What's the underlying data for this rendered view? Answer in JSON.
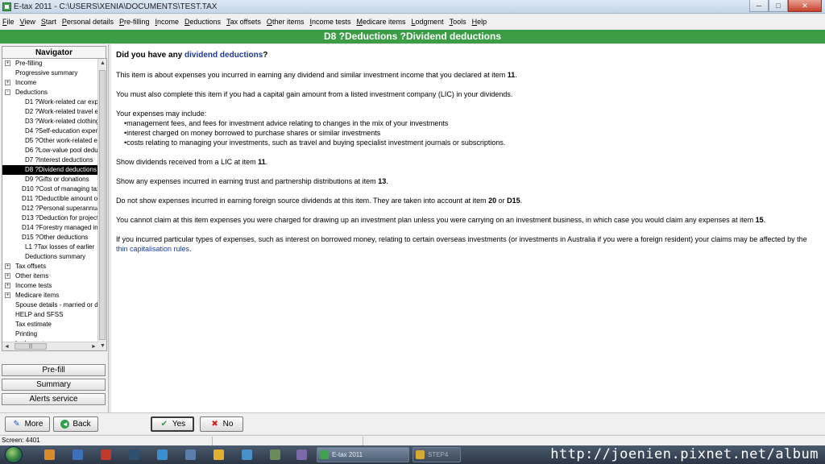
{
  "window": {
    "title": "E-tax 2011 - C:\\USERS\\XENIA\\DOCUMENTS\\TEST.TAX",
    "minimize": "─",
    "maximize": "□",
    "close": "✕"
  },
  "menu": [
    {
      "u": "F",
      "rest": "ile"
    },
    {
      "u": "V",
      "rest": "iew"
    },
    {
      "u": "S",
      "rest": "tart"
    },
    {
      "u": "P",
      "rest": "ersonal details"
    },
    {
      "u": "P",
      "rest": "re-filling"
    },
    {
      "u": "I",
      "rest": "ncome"
    },
    {
      "u": "D",
      "rest": "eductions"
    },
    {
      "u": "T",
      "rest": "ax offsets"
    },
    {
      "u": "O",
      "rest": "ther items"
    },
    {
      "u": "I",
      "rest": "ncome tests"
    },
    {
      "u": "M",
      "rest": "edicare items"
    },
    {
      "u": "L",
      "rest": "odgment"
    },
    {
      "u": "T",
      "rest": "ools"
    },
    {
      "u": "H",
      "rest": "elp"
    }
  ],
  "header": {
    "title": "D8 ?Deductions ?Dividend deductions"
  },
  "navigator": {
    "title": "Navigator",
    "items": [
      {
        "label": "Pre-filling",
        "indent": 0,
        "pm": "+"
      },
      {
        "label": "Progressive summary",
        "indent": 0,
        "pm": ""
      },
      {
        "label": "Income",
        "indent": 0,
        "pm": "+"
      },
      {
        "label": "Deductions",
        "indent": 0,
        "pm": "-"
      },
      {
        "label": "D1 ?Work-related car exp",
        "indent": 1,
        "pm": ""
      },
      {
        "label": "D2 ?Work-related travel e",
        "indent": 1,
        "pm": ""
      },
      {
        "label": "D3 ?Work-related clothing",
        "indent": 1,
        "pm": ""
      },
      {
        "label": "D4 ?Self-education exper",
        "indent": 1,
        "pm": ""
      },
      {
        "label": "D5 ?Other work-related e",
        "indent": 1,
        "pm": ""
      },
      {
        "label": "D6 ?Low-value pool dedu",
        "indent": 1,
        "pm": ""
      },
      {
        "label": "D7 ?Interest deductions",
        "indent": 1,
        "pm": ""
      },
      {
        "label": "D8 ?Dividend deductions",
        "indent": 1,
        "pm": "",
        "selected": true
      },
      {
        "label": "D9 ?Gifts or donations",
        "indent": 1,
        "pm": ""
      },
      {
        "label": "D10 ?Cost of managing tax",
        "indent": 2,
        "pm": ""
      },
      {
        "label": "D11 ?Deductible amount o",
        "indent": 2,
        "pm": ""
      },
      {
        "label": "D12 ?Personal superannua",
        "indent": 2,
        "pm": ""
      },
      {
        "label": "D13 ?Deduction for project",
        "indent": 2,
        "pm": ""
      },
      {
        "label": "D14 ?Forestry managed in",
        "indent": 2,
        "pm": ""
      },
      {
        "label": "D15 ?Other deductions",
        "indent": 2,
        "pm": ""
      },
      {
        "label": "L1 ?Tax losses of earlier",
        "indent": 1,
        "pm": ""
      },
      {
        "label": "Deductions summary",
        "indent": 1,
        "pm": ""
      },
      {
        "label": "Tax offsets",
        "indent": 0,
        "pm": "+"
      },
      {
        "label": "Other items",
        "indent": 0,
        "pm": "+"
      },
      {
        "label": "Income tests",
        "indent": 0,
        "pm": "+"
      },
      {
        "label": "Medicare items",
        "indent": 0,
        "pm": "+"
      },
      {
        "label": "Spouse details - married or d",
        "indent": 0,
        "pm": ""
      },
      {
        "label": "HELP and SFSS",
        "indent": 0,
        "pm": ""
      },
      {
        "label": "Tax estimate",
        "indent": 0,
        "pm": ""
      },
      {
        "label": "Printing",
        "indent": 0,
        "pm": ""
      },
      {
        "label": "Lodgment",
        "indent": 0,
        "pm": ""
      }
    ],
    "buttons": {
      "prefill": "Pre-fill",
      "summary": "Summary",
      "alerts": "Alerts service"
    },
    "hscroll_label": "|||"
  },
  "content": {
    "question_pre": "Did you have any ",
    "question_link": "dividend deductions",
    "question_post": "?",
    "p1_pre": "This item is about expenses you incurred in earning any dividend and similar investment income that you declared at item ",
    "p1_bold": "11",
    "p1_post": ".",
    "p2": "You must also complete this item if you had a capital gain amount from a listed investment company (LIC) in your dividends.",
    "p3_intro": "Your expenses may include:",
    "p3_bullets": [
      "•management fees, and fees for investment advice relating to changes in the mix of your investments",
      "•interest charged on money borrowed to purchase shares or similar investments",
      "•costs relating to managing your investments, such as travel and buying specialist investment journals or subscriptions."
    ],
    "p4_pre": "Show dividends received from a LIC at item ",
    "p4_bold": "11",
    "p4_post": ".",
    "p5_pre": "Show any expenses incurred in earning trust and partnership distributions at item ",
    "p5_bold": "13",
    "p5_post": ".",
    "p6_pre": "Do not show expenses incurred in earning foreign source dividends at this item. They are taken into account at item ",
    "p6_bold1": "20",
    "p6_mid": " or ",
    "p6_bold2": "D15",
    "p6_post": ".",
    "p7_pre": "You cannot claim at this item expenses you were charged for drawing up an investment plan unless you were carrying on an investment business, in which case you would claim any expenses at item ",
    "p7_bold": "15",
    "p7_post": ".",
    "p8_pre": "If you incurred particular types of expenses, such as interest on borrowed money, relating to certain overseas investments (or investments in Australia if you were a foreign resident) your claims may be affected by the ",
    "p8_link": "thin capitalisation rules",
    "p8_post": "."
  },
  "buttons": {
    "more": "More",
    "back": "Back",
    "yes": "Yes",
    "no": "No"
  },
  "status": {
    "text": "Screen: 4401"
  },
  "taskbar": {
    "task1": "E-tax 2011",
    "task2": "STEP4",
    "watermark": "http://joenien.pixnet.net/album"
  },
  "colors": {
    "header_green": "#3c9d46",
    "link_blue": "#1a3a9e"
  }
}
